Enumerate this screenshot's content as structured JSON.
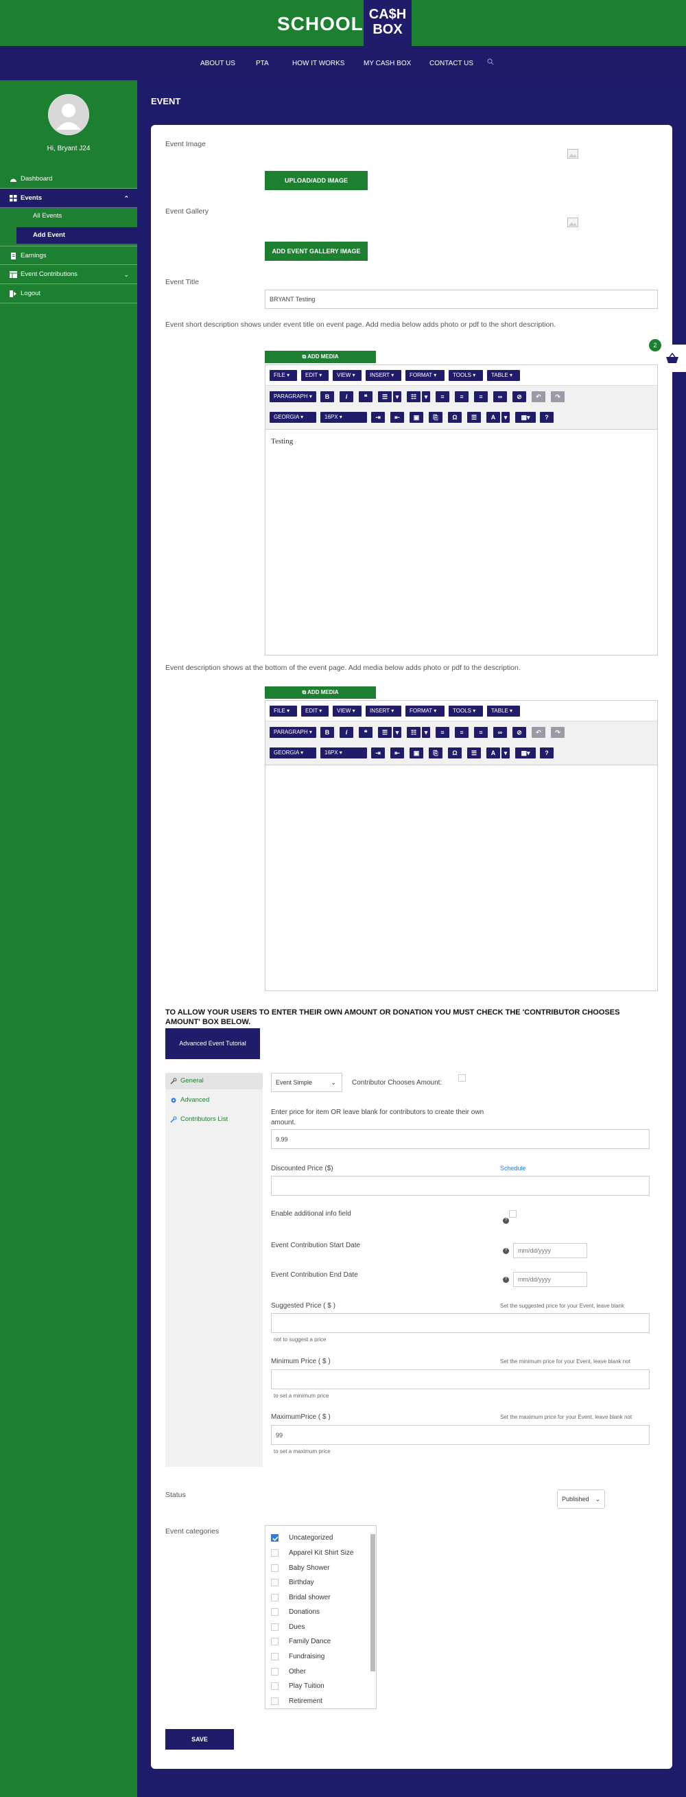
{
  "header": {
    "logo_left": "SCHOOL",
    "logo_right_line1": "CA$H",
    "logo_right_line2": "BOX"
  },
  "nav": {
    "items": [
      "ABOUT US",
      "PTA",
      "HOW IT WORKS",
      "MY CASH BOX",
      "CONTACT US"
    ],
    "search_icon": "search-icon"
  },
  "sidebar": {
    "greeting": "Hi, Bryant J24",
    "items": [
      {
        "label": "Dashboard",
        "icon": "dashboard-icon"
      },
      {
        "label": "Events",
        "icon": "grid-icon"
      },
      {
        "label": "All Events"
      },
      {
        "label": "Add Event"
      },
      {
        "label": "Earnings",
        "icon": "document-icon"
      },
      {
        "label": "Event Contributions",
        "icon": "table-icon"
      },
      {
        "label": "Logout",
        "icon": "logout-icon"
      }
    ]
  },
  "page": {
    "title": "EVENT"
  },
  "form": {
    "event_image_label": "Event Image",
    "upload_button": "UPLOAD/ADD IMAGE",
    "event_gallery_label": "Event Gallery",
    "gallery_button": "ADD EVENT GALLERY IMAGE",
    "event_title_label": "Event Title",
    "event_title_value": "BRYANT Testing",
    "short_desc_label": "Event short description shows under event title on event page. Add media below adds photo or pdf to the short description.",
    "add_media": "ADD MEDIA",
    "short_desc_content": "Testing",
    "desc_label": "Event description shows at the bottom of the event page. Add media below adds photo or pdf to the description."
  },
  "editor": {
    "menus": [
      "FILE",
      "EDIT",
      "VIEW",
      "INSERT",
      "FORMAT",
      "TOOLS",
      "TABLE"
    ],
    "block_format": "PARAGRAPH",
    "font_family": "GEORGIA",
    "font_size": "16PX"
  },
  "cart": {
    "count": "2"
  },
  "pricing": {
    "warning": "TO ALLOW YOUR USERS TO ENTER THEIR OWN AMOUNT OR DONATION YOU MUST CHECK THE 'CONTRIBUTOR CHOOSES AMOUNT' BOX BELOW.",
    "tutorial_button": "Advanced Event Tutorial",
    "tabs": [
      "General",
      "Advanced",
      "Contributors List"
    ],
    "event_type": "Event Simple",
    "contributor_chooses": "Contributor Chooses Amount:",
    "price_help": "Enter price for item OR leave blank for contributors to create their own amount.",
    "price_value": "9.99",
    "discounted_label": "Discounted Price ($)",
    "schedule_link": "Schedule",
    "additional_info_label": "Enable additional info field",
    "start_date_label": "Event Contribution Start Date",
    "end_date_label": "Event Contribution End Date",
    "date_placeholder": "mm/dd/yyyy",
    "suggested_label": "Suggested Price ( $ )",
    "suggested_help_a": "Set the suggested price for your Event, leave blank",
    "suggested_help_b": "not to suggest a price",
    "minimum_label": "Minimum Price ( $ )",
    "minimum_help_a": "Set the minimum price for your Event, leave blank not",
    "minimum_help_b": "to set a minimum price",
    "maximum_label": "MaximumPrice ( $ )",
    "maximum_value": "99",
    "maximum_help_a": "Set the maximum price for your Event, leave blank not",
    "maximum_help_b": "to set a maximum price"
  },
  "status": {
    "label": "Status",
    "value": "Published"
  },
  "categories": {
    "label": "Event categories",
    "items": [
      {
        "name": "Uncategorized",
        "checked": true
      },
      {
        "name": "Apparel Kit Shirt Size",
        "checked": false
      },
      {
        "name": "Baby Shower",
        "checked": false
      },
      {
        "name": "Birthday",
        "checked": false
      },
      {
        "name": "Bridal shower",
        "checked": false
      },
      {
        "name": "Donations",
        "checked": false
      },
      {
        "name": "Dues",
        "checked": false
      },
      {
        "name": "Family Dance",
        "checked": false
      },
      {
        "name": "Fundraising",
        "checked": false
      },
      {
        "name": "Other",
        "checked": false
      },
      {
        "name": "Play Tuition",
        "checked": false
      },
      {
        "name": "Retirement",
        "checked": false
      }
    ]
  },
  "save_button": "SAVE",
  "colors": {
    "green": "#1d8031",
    "navy": "#211c6a",
    "check_blue": "#2b7de9"
  }
}
